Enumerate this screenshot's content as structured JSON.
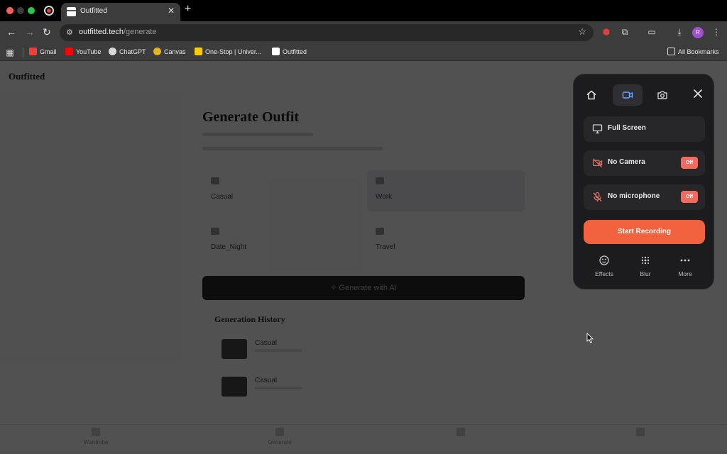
{
  "browser": {
    "tab": {
      "title": "Outfitted"
    },
    "address": {
      "host": "outfitted.tech",
      "path": "/generate"
    },
    "profile_initial": "R",
    "bookmarks": [
      {
        "label": "Gmail",
        "color": "#ea4335"
      },
      {
        "label": "YouTube",
        "color": "#ff0000"
      },
      {
        "label": "ChatGPT",
        "color": "#d9d9d9"
      },
      {
        "label": "Canvas",
        "color": "#e2b325"
      },
      {
        "label": "One-Stop | Univer...",
        "color": "#ffcb05"
      },
      {
        "label": "Outfitted",
        "color": "#ffffff"
      }
    ],
    "all_bookmarks": "All Bookmarks"
  },
  "page": {
    "logo": "Outfitted",
    "title": "Generate Outfit",
    "options": [
      {
        "label": "Casual",
        "selected": false
      },
      {
        "label": "Work",
        "selected": true
      },
      {
        "label": "Date_Night",
        "selected": false
      },
      {
        "label": "Travel",
        "selected": false
      }
    ],
    "generate_label": "Generate with AI",
    "history_title": "Generation History",
    "history": [
      {
        "label": "Casual"
      },
      {
        "label": "Casual"
      }
    ],
    "bottom_nav": [
      "Wardrobe",
      "Generate",
      "",
      ""
    ]
  },
  "recorder": {
    "rows": {
      "screen": "Full Screen",
      "camera": "No Camera",
      "camera_toggle": "Off",
      "mic": "No microphone",
      "mic_toggle": "Off"
    },
    "start_label": "Start Recording",
    "tools": [
      "Effects",
      "Blur",
      "More"
    ],
    "colors": {
      "accent": "#f2623f",
      "toggle": "#f26b5f",
      "active_tab_icon": "#6aa6ff"
    }
  }
}
